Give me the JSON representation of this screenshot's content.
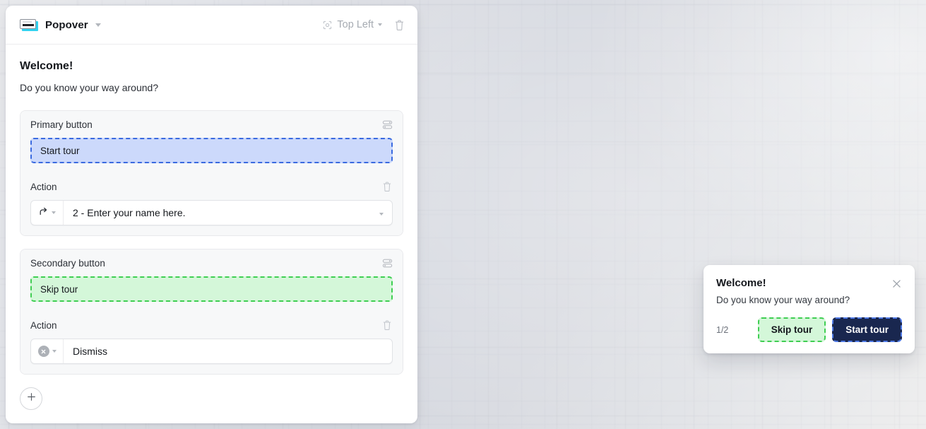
{
  "editor": {
    "header": {
      "type_icon": "popover-icon",
      "title": "Popover",
      "title_caret": "chevron-down-icon",
      "position_icon": "anchor-target-icon",
      "position_label": "Top Left",
      "position_caret": "chevron-down-icon",
      "delete_icon": "trash-icon"
    },
    "content": {
      "title": "Welcome!",
      "subtitle": "Do you know your way around?"
    },
    "primary": {
      "section_label": "Primary button",
      "section_icon": "sliders-icon",
      "button_text": "Start tour",
      "action_label": "Action",
      "action_delete_icon": "trash-icon",
      "action_type_icon": "goto-arrow-icon",
      "action_value": "2 - Enter your name here.",
      "action_caret": "chevron-down-icon"
    },
    "secondary": {
      "section_label": "Secondary button",
      "section_icon": "sliders-icon",
      "button_text": "Skip tour",
      "action_label": "Action",
      "action_delete_icon": "trash-icon",
      "action_type_icon": "dismiss-circle-x-icon",
      "action_value": "Dismiss",
      "action_caret": "chevron-down-icon"
    },
    "add_button": {
      "icon": "plus-icon",
      "label": ""
    }
  },
  "preview": {
    "title": "Welcome!",
    "subtitle": "Do you know your way around?",
    "close_icon": "close-x-icon",
    "counter": "1/2",
    "secondary_button": "Skip tour",
    "primary_button": "Start tour"
  },
  "colors": {
    "primary_highlight_fill": "#ccd9fb",
    "primary_highlight_border": "#3a6ae0",
    "secondary_highlight_fill": "#d4f7d9",
    "secondary_highlight_border": "#3fce52",
    "preview_primary_bg": "#19274f",
    "type_icon_accent": "#31d2ef",
    "panel_bg": "#ffffff",
    "field_bg": "#f7f8f9"
  }
}
